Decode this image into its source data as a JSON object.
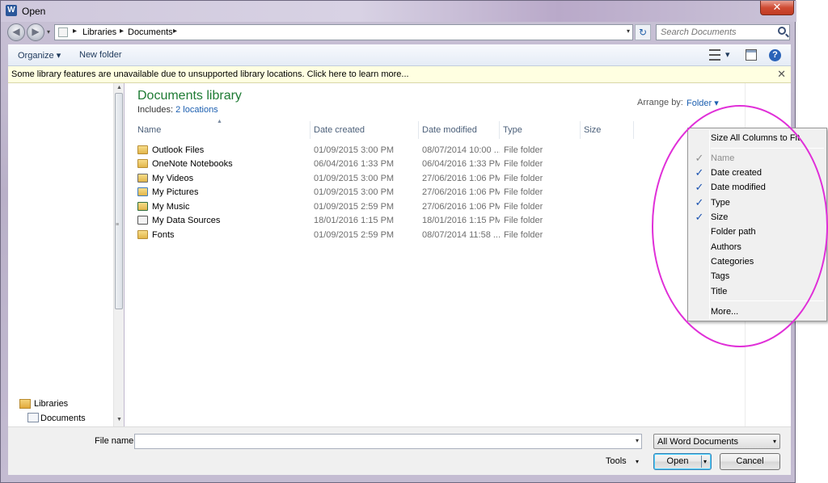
{
  "window": {
    "title": "Open",
    "app_icon": "W",
    "close_glyph": "✕"
  },
  "address": {
    "crumbs": [
      "Libraries",
      "Documents"
    ],
    "separator": "▸",
    "search_placeholder": "Search Documents"
  },
  "toolbar": {
    "organize_label": "Organize ▾",
    "new_folder_label": "New folder",
    "view_drop": "▾",
    "help_glyph": "?"
  },
  "infobar": {
    "message": "Some library features are unavailable due to unsupported library locations. Click here to learn more...",
    "close_glyph": "✕"
  },
  "navpane": {
    "items": [
      {
        "label": "Libraries"
      },
      {
        "label": "Documents"
      }
    ]
  },
  "library": {
    "title": "Documents library",
    "includes_label": "Includes:",
    "includes_link": "2 locations",
    "arrange_label": "Arrange by:",
    "arrange_value": "Folder ▾"
  },
  "columns": {
    "name": "Name",
    "date_created": "Date created",
    "date_modified": "Date modified",
    "type": "Type",
    "size": "Size"
  },
  "files": [
    {
      "name": "Outlook Files",
      "created": "01/09/2015 3:00 PM",
      "modified": "08/07/2014 10:00 ...",
      "type": "File folder",
      "icon": "folder-icon"
    },
    {
      "name": "OneNote Notebooks",
      "created": "06/04/2016 1:33 PM",
      "modified": "06/04/2016 1:33 PM",
      "type": "File folder",
      "icon": "folder-icon"
    },
    {
      "name": "My Videos",
      "created": "01/09/2015 3:00 PM",
      "modified": "27/06/2016 1:06 PM",
      "type": "File folder",
      "icon": "videos-folder-icon"
    },
    {
      "name": "My Pictures",
      "created": "01/09/2015 3:00 PM",
      "modified": "27/06/2016 1:06 PM",
      "type": "File folder",
      "icon": "pictures-folder-icon"
    },
    {
      "name": "My Music",
      "created": "01/09/2015 2:59 PM",
      "modified": "27/06/2016 1:06 PM",
      "type": "File folder",
      "icon": "music-folder-icon"
    },
    {
      "name": "My Data Sources",
      "created": "18/01/2016 1:15 PM",
      "modified": "18/01/2016 1:15 PM",
      "type": "File folder",
      "icon": "data-sources-folder-icon"
    },
    {
      "name": "Fonts",
      "created": "01/09/2015 2:59 PM",
      "modified": "08/07/2014 11:58 ...",
      "type": "File folder",
      "icon": "folder-icon"
    }
  ],
  "context_menu": {
    "size_all": "Size All Columns to Fit",
    "items": [
      {
        "label": "Name",
        "checked": true,
        "disabled": true
      },
      {
        "label": "Date created",
        "checked": true,
        "disabled": false
      },
      {
        "label": "Date modified",
        "checked": true,
        "disabled": false
      },
      {
        "label": "Type",
        "checked": true,
        "disabled": false
      },
      {
        "label": "Size",
        "checked": true,
        "disabled": false
      },
      {
        "label": "Folder path",
        "checked": false,
        "disabled": false
      },
      {
        "label": "Authors",
        "checked": false,
        "disabled": false
      },
      {
        "label": "Categories",
        "checked": false,
        "disabled": false
      },
      {
        "label": "Tags",
        "checked": false,
        "disabled": false
      },
      {
        "label": "Title",
        "checked": false,
        "disabled": false
      }
    ],
    "more": "More...",
    "check_glyph": "✓",
    "highlight_color": "#e02fd8"
  },
  "bottom": {
    "filename_label": "File name:",
    "filename_value": "",
    "filter_value": "All Word Documents",
    "tools_label": "Tools",
    "open_label": "Open",
    "cancel_label": "Cancel",
    "drop_glyph": "▾"
  }
}
